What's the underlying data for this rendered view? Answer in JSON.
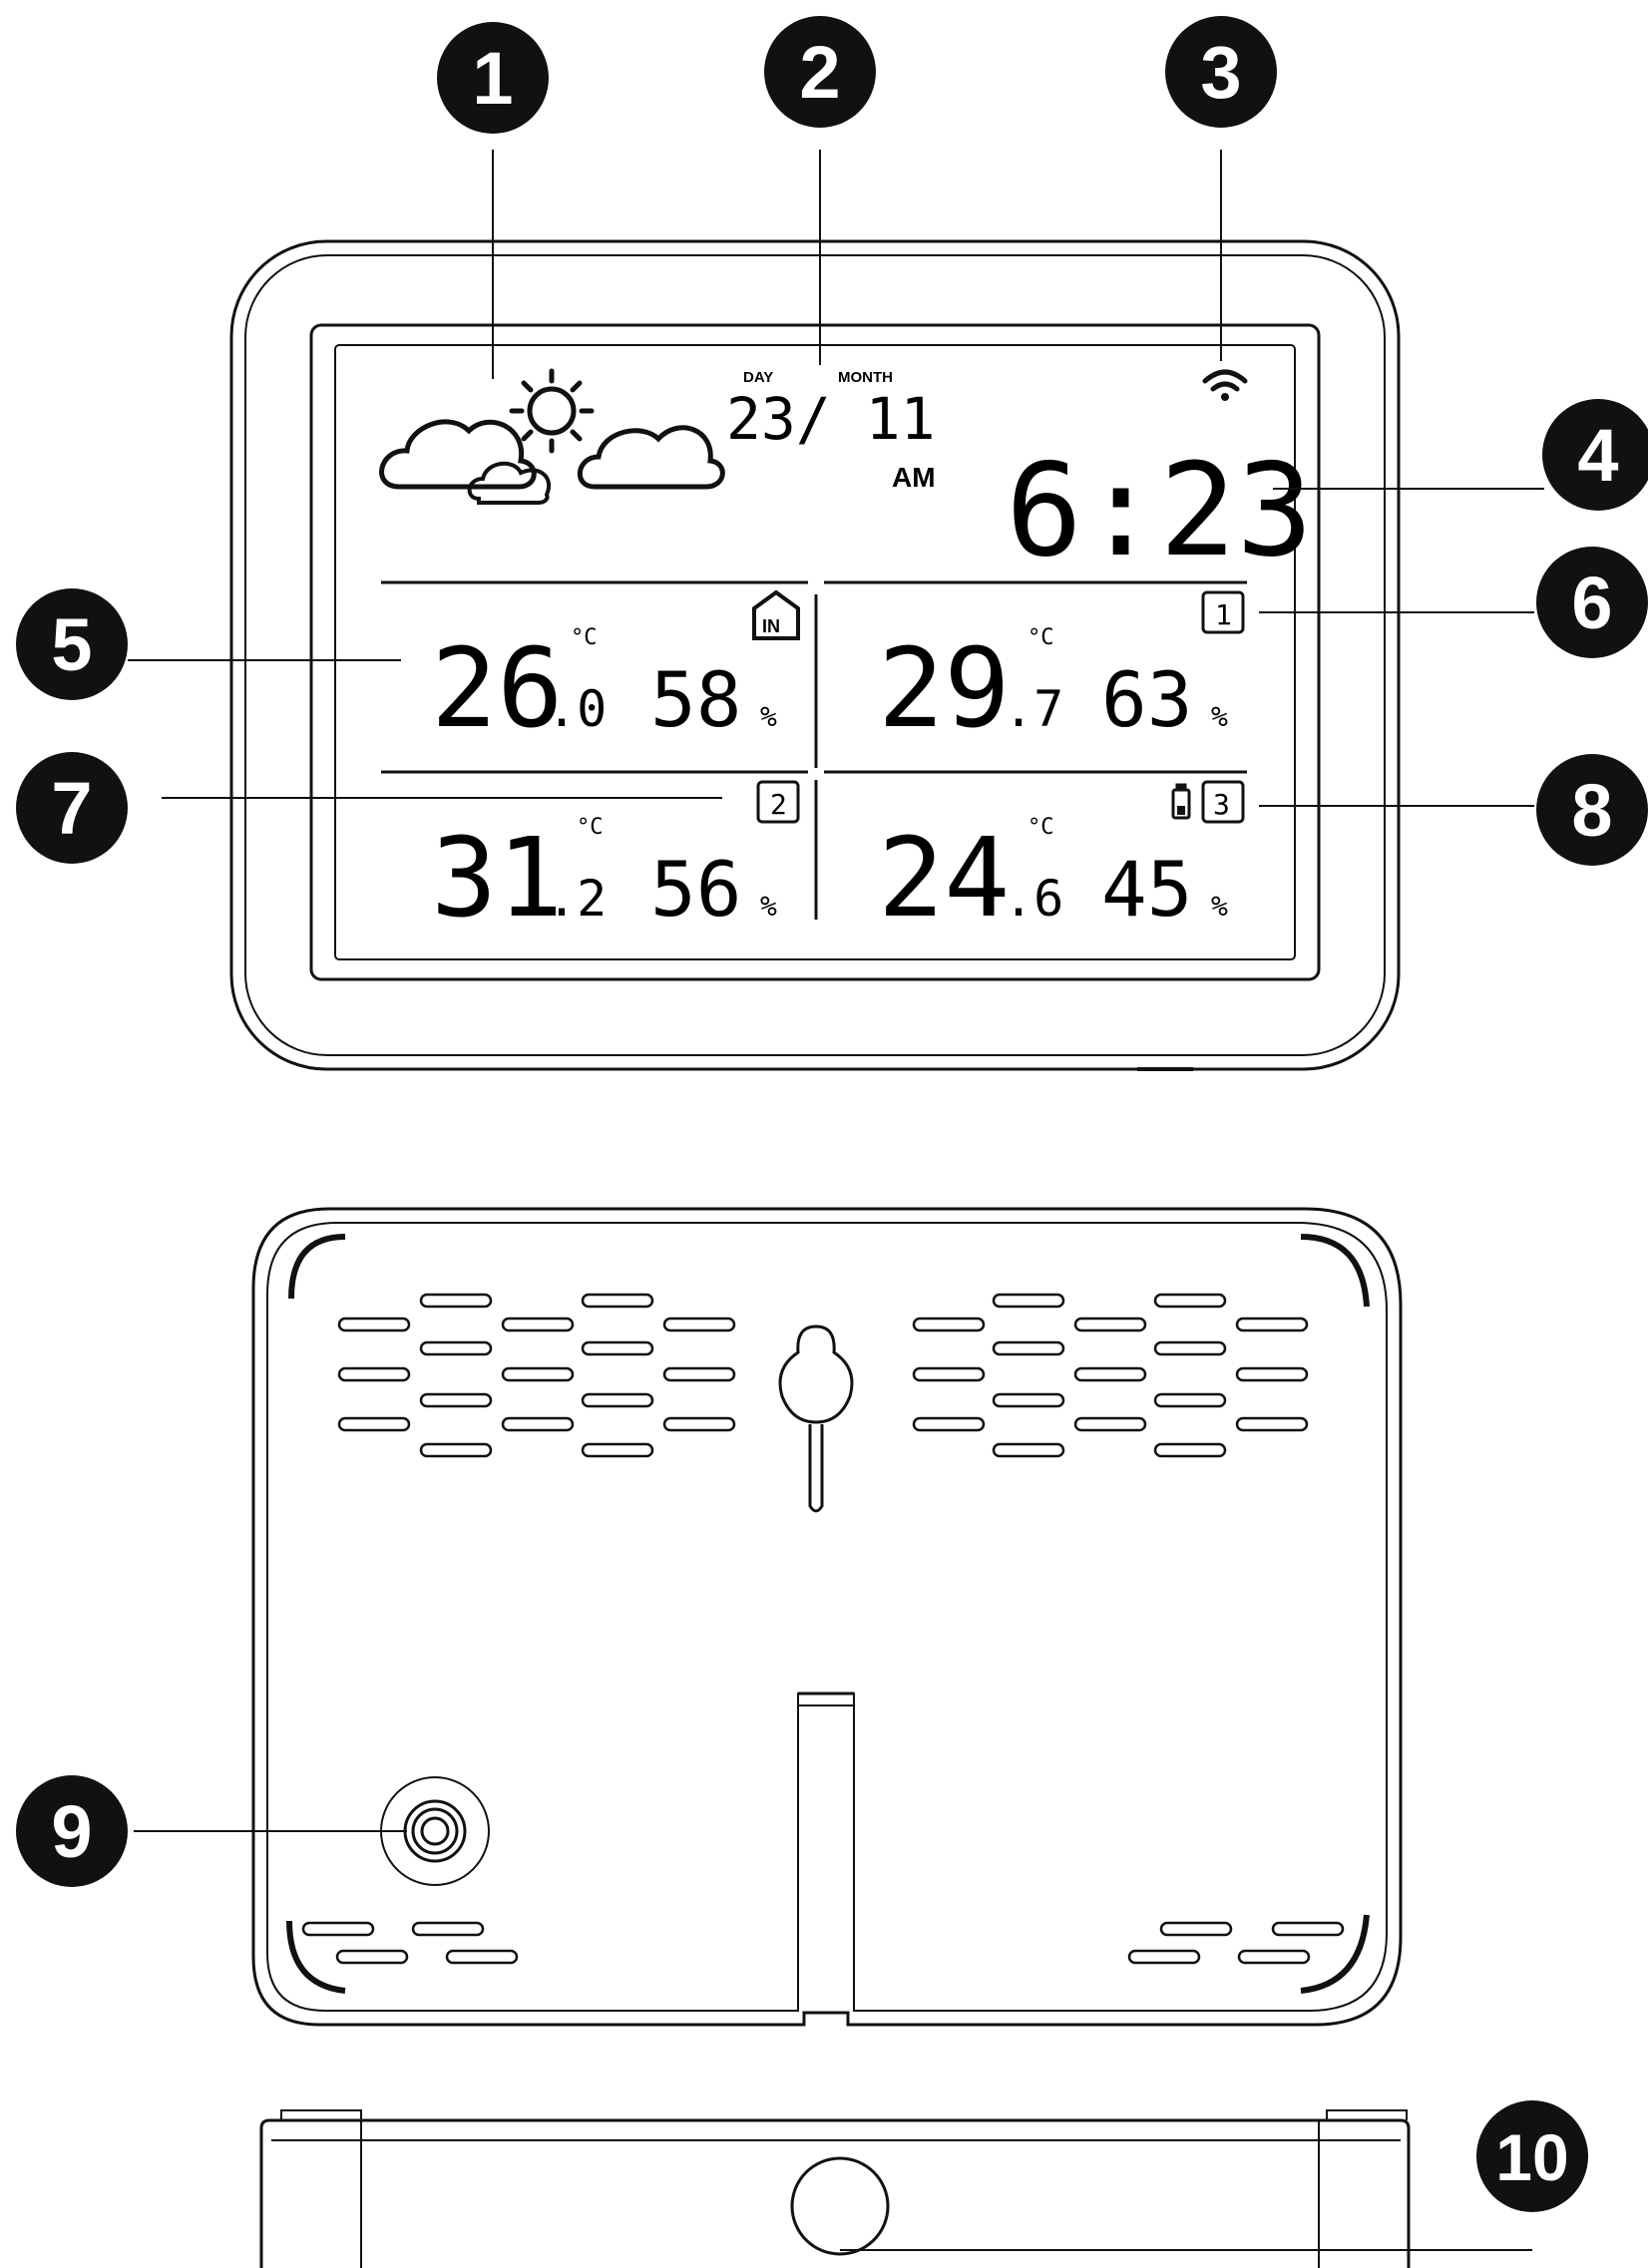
{
  "callouts": [
    "1",
    "2",
    "3",
    "4",
    "5",
    "6",
    "7",
    "8",
    "9",
    "10"
  ],
  "display": {
    "day_label": "DAY",
    "month_label": "MONTH",
    "date": "23/ 11",
    "ampm": "AM",
    "time": "6:23",
    "temp_unit": "°C",
    "percent": "%",
    "indoor_tag": "IN",
    "indoor": {
      "temp_int": "26",
      "temp_dec": ".0",
      "humidity": "58"
    },
    "ch1": {
      "tag": "1",
      "temp_int": "29",
      "temp_dec": ".7",
      "humidity": "63"
    },
    "ch2": {
      "tag": "2",
      "temp_int": "31",
      "temp_dec": ".2",
      "humidity": "56"
    },
    "ch3": {
      "tag": "3",
      "temp_int": "24",
      "temp_dec": ".6",
      "humidity": "45"
    }
  },
  "icons": {
    "weather": "partly-cloudy-icon",
    "signal": "wifi-signal-icon",
    "home": "home-icon",
    "battery": "low-battery-icon",
    "hanging_hole": "keyhole-icon",
    "sensor": "sensor-port-icon",
    "button": "round-button-icon"
  },
  "colors": {
    "line": "#111111",
    "callout_fill": "#111111",
    "callout_text": "#ffffff"
  }
}
